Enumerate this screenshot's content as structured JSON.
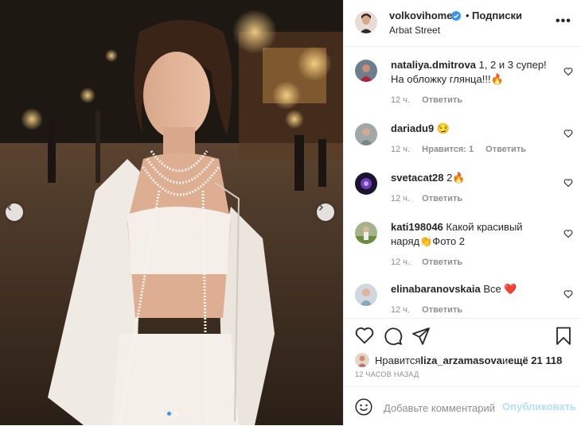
{
  "post": {
    "author": "volkovihome",
    "follow_label": "Подписки",
    "separator": "•",
    "location": "Arbat Street",
    "more_label": "•••",
    "photo_description": "Woman in white outfit with pearl necklaces on a night street"
  },
  "comments": [
    {
      "user": "nataliya.dmitrova",
      "text": " 1, 2 и 3 супер! На обложку глянца!!!🔥",
      "time": "12 ч.",
      "likes": "",
      "reply": "Ответить"
    },
    {
      "user": "dariadu9",
      "text": " 😏",
      "time": "12 ч.",
      "likes": "Нравится: 1",
      "reply": "Ответить"
    },
    {
      "user": "svetacat28",
      "text": " 2🔥",
      "time": "12 ч.",
      "likes": "",
      "reply": "Ответить"
    },
    {
      "user": "kati198046",
      "text": " Какой красивый наряд👏Фото 2",
      "time": "12 ч.",
      "likes": "",
      "reply": "Ответить"
    },
    {
      "user": "elinabaranovskaia",
      "text": " Все ❤️",
      "time": "12 ч.",
      "likes": "",
      "reply": "Ответить"
    }
  ],
  "likes_row": {
    "prefix": "Нравится ",
    "user": "liza_arzamasova",
    "middle": " и ",
    "count": "ещё 21 118"
  },
  "timestamp": "12 ЧАСОВ НАЗАД",
  "composer": {
    "placeholder": "Добавьте комментарий...",
    "publish_label": "Опубликовать"
  },
  "carousel": {
    "current": 2,
    "total": 3
  },
  "colors": {
    "accent": "#3897f0",
    "publish_disabled": "#b2dffc",
    "muted": "#8e8e8e",
    "text": "#262626",
    "like_red": "#ed4956"
  }
}
